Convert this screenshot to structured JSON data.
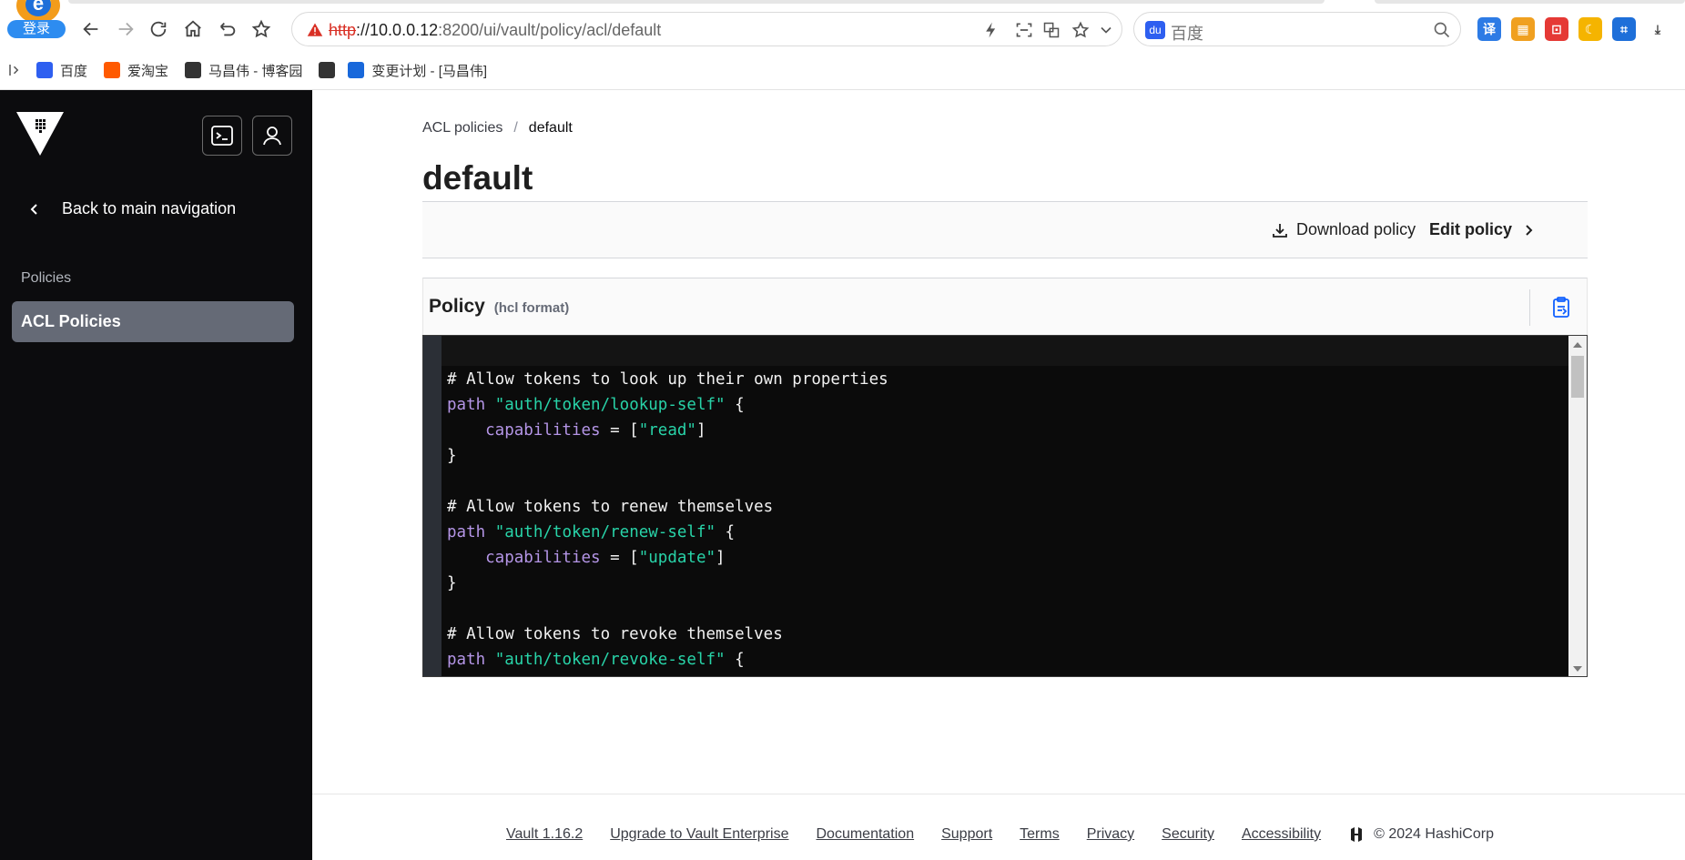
{
  "browser": {
    "login_label": "登录",
    "url_scheme": "http",
    "url_host": "://10.0.0.12",
    "url_rest": ":8200/ui/vault/policy/acl/default",
    "search_placeholder": "百度",
    "extensions": [
      {
        "icon": "translate-icon",
        "glyph": "译",
        "color": "#2d7be5"
      },
      {
        "icon": "apps-icon",
        "glyph": "▦",
        "color": "#f0a020"
      },
      {
        "icon": "pdf-icon",
        "glyph": "⊡",
        "color": "#e53935"
      },
      {
        "icon": "moon-icon",
        "glyph": "☾",
        "color": "#f5b400"
      },
      {
        "icon": "crop-icon",
        "glyph": "⌗",
        "color": "#1e6fd9"
      },
      {
        "icon": "download-icon",
        "glyph": "⤓",
        "color": "#444444"
      }
    ],
    "bookmarks": [
      {
        "label": "百度",
        "icon": "baidu-icon",
        "color": "#2e5ff0"
      },
      {
        "label": "爱淘宝",
        "icon": "taobao-icon",
        "color": "#ff5a00"
      },
      {
        "label": "马昌伟 - 博客园",
        "icon": "cnblogs-icon",
        "color": "#333333"
      },
      {
        "label": "",
        "icon": "cnblogs-icon",
        "color": "#333333"
      },
      {
        "label": "变更计划 - [马昌伟]",
        "icon": "confluence-icon",
        "color": "#1868db"
      }
    ]
  },
  "sidebar": {
    "back_label": "Back to main navigation",
    "section_label": "Policies",
    "active_item": "ACL Policies"
  },
  "main": {
    "breadcrumb": {
      "parent": "ACL policies",
      "current": "default"
    },
    "title": "default",
    "toolbar": {
      "download_label": "Download policy",
      "edit_label": "Edit policy"
    },
    "policy": {
      "title": "Policy",
      "subtitle": "(hcl format)"
    }
  },
  "code_lines": [
    [
      {
        "t": "# Allow tokens to look up their own properties",
        "c": "cmt"
      }
    ],
    [
      {
        "t": "path ",
        "c": "kw"
      },
      {
        "t": "\"auth/token/lookup-self\"",
        "c": "str"
      },
      {
        "t": " {",
        "c": ""
      }
    ],
    [
      {
        "t": "    capabilities",
        "c": "kw"
      },
      {
        "t": " = [",
        "c": ""
      },
      {
        "t": "\"read\"",
        "c": "str"
      },
      {
        "t": "]",
        "c": ""
      }
    ],
    [
      {
        "t": "}",
        "c": ""
      }
    ],
    [
      {
        "t": "",
        "c": ""
      }
    ],
    [
      {
        "t": "# Allow tokens to renew themselves",
        "c": "cmt"
      }
    ],
    [
      {
        "t": "path ",
        "c": "kw"
      },
      {
        "t": "\"auth/token/renew-self\"",
        "c": "str"
      },
      {
        "t": " {",
        "c": ""
      }
    ],
    [
      {
        "t": "    capabilities",
        "c": "kw"
      },
      {
        "t": " = [",
        "c": ""
      },
      {
        "t": "\"update\"",
        "c": "str"
      },
      {
        "t": "]",
        "c": ""
      }
    ],
    [
      {
        "t": "}",
        "c": ""
      }
    ],
    [
      {
        "t": "",
        "c": ""
      }
    ],
    [
      {
        "t": "# Allow tokens to revoke themselves",
        "c": "cmt"
      }
    ],
    [
      {
        "t": "path ",
        "c": "kw"
      },
      {
        "t": "\"auth/token/revoke-self\"",
        "c": "str"
      },
      {
        "t": " {",
        "c": ""
      }
    ]
  ],
  "footer": {
    "links": [
      "Vault 1.16.2",
      "Upgrade to Vault Enterprise",
      "Documentation",
      "Support",
      "Terms",
      "Privacy",
      "Security",
      "Accessibility"
    ],
    "copyright": "© 2024 HashiCorp"
  }
}
